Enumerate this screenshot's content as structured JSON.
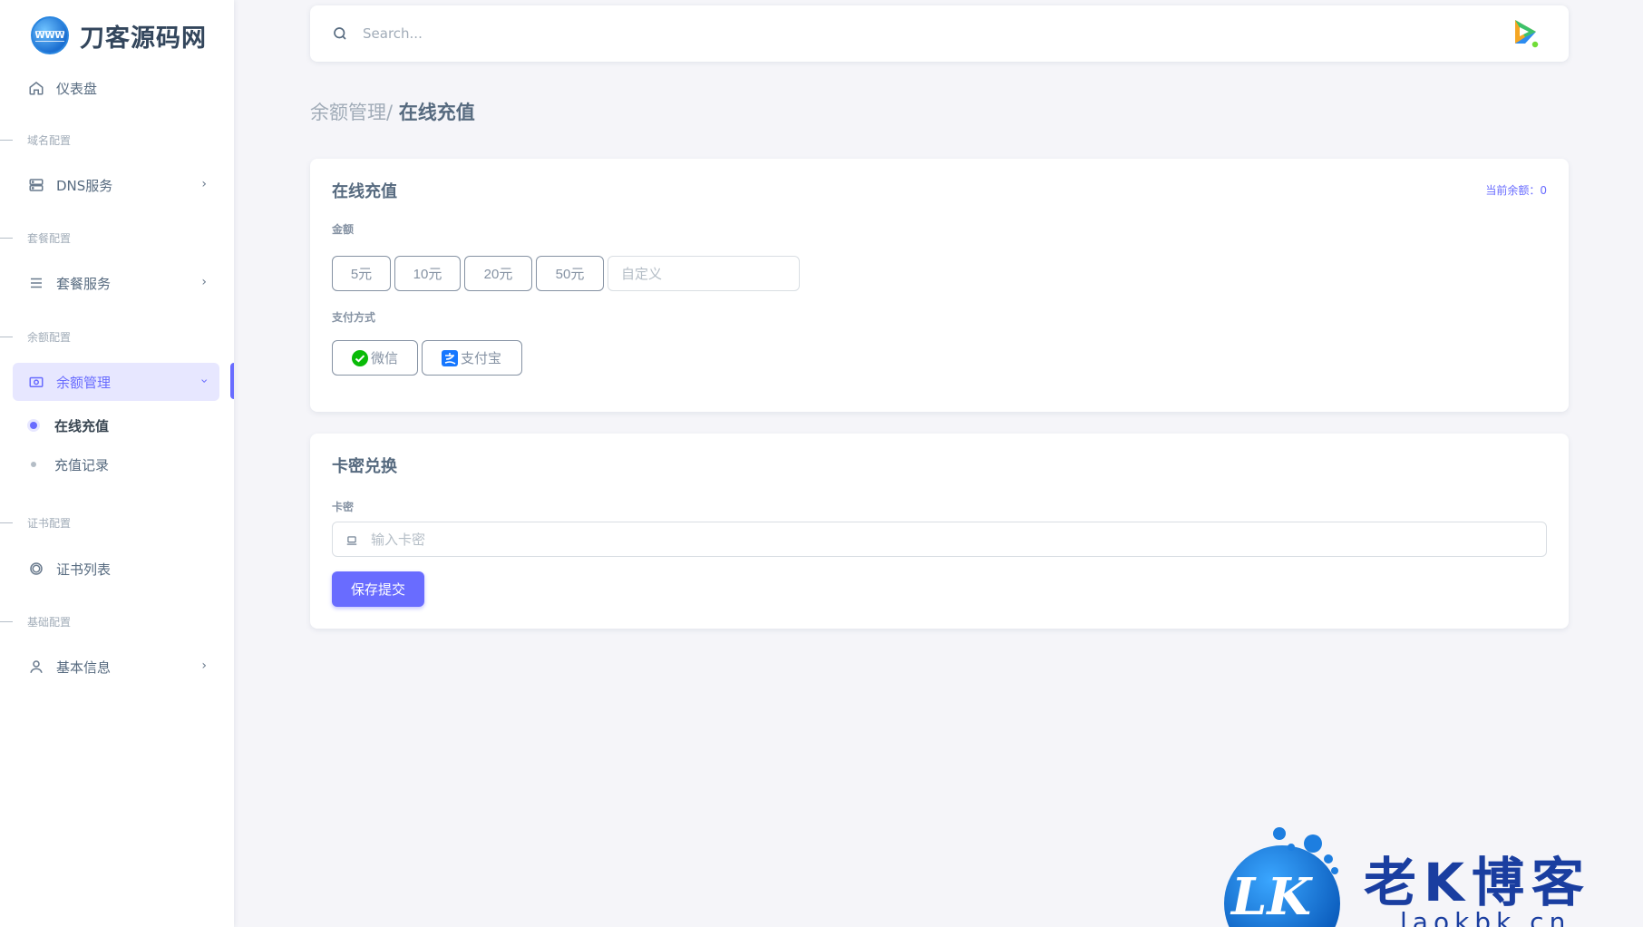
{
  "brand": {
    "name": "刀客源码网",
    "logo_text": "WWW"
  },
  "sidebar": {
    "dashboard": "仪表盘",
    "sections": {
      "domain": "域名配置",
      "package": "套餐配置",
      "balance": "余额配置",
      "cert": "证书配置",
      "basic": "基础配置"
    },
    "items": {
      "dns": "DNS服务",
      "package": "套餐服务",
      "balance": "余额管理",
      "cert": "证书列表",
      "basic": "基本信息"
    },
    "sub_items": {
      "recharge": "在线充值",
      "records": "充值记录"
    }
  },
  "navbar": {
    "search_placeholder": "Search...",
    "avatar_status_color": "#71dd37"
  },
  "breadcrumb": {
    "parent": "余额管理/",
    "current": "在线充值"
  },
  "recharge_card": {
    "title": "在线充值",
    "balance_label": "当前余额：0",
    "amount_label": "金额",
    "amounts": [
      "5元",
      "10元",
      "20元",
      "50元"
    ],
    "custom_placeholder": "自定义",
    "payment_label": "支付方式",
    "payments": [
      "微信",
      "支付宝"
    ]
  },
  "card_redeem": {
    "title": "卡密兑换",
    "field_label": "卡密",
    "placeholder": "输入卡密",
    "submit": "保存提交"
  },
  "watermark": {
    "logo": "LK",
    "text": "老K博客",
    "url": "laokbk.cn"
  },
  "colors": {
    "primary": "#696cff",
    "text": "#566a7f",
    "muted": "#a1acb8",
    "background": "#f5f5f9",
    "wechat": "#09bb07",
    "alipay": "#1677ff"
  }
}
